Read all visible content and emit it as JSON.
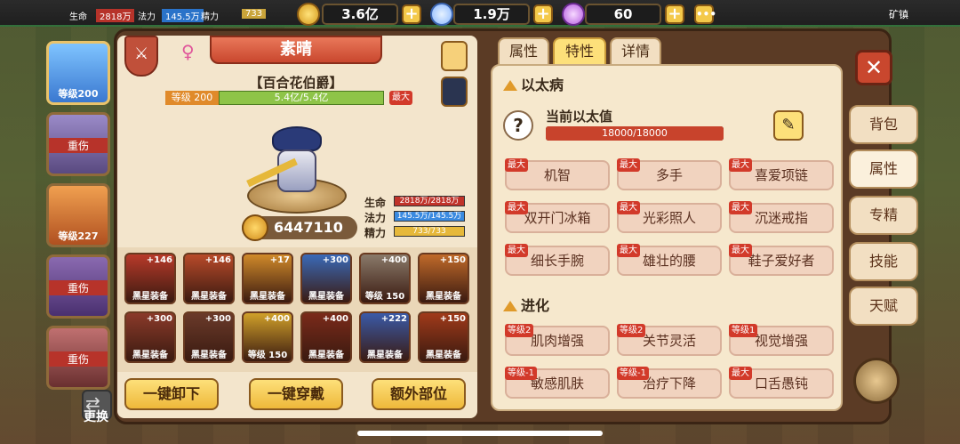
{
  "topbar": {
    "hp_label": "生命",
    "hp_value": "2818万",
    "mp_label": "法力",
    "mp_value": "145.5万",
    "spirit_label": "精力",
    "spirit_value": "733",
    "gold": "3.6亿",
    "gems": "1.9万",
    "crystals": "60",
    "mine_label": "矿镇"
  },
  "heroes": [
    {
      "label": "等级200"
    },
    {
      "label": "重伤"
    },
    {
      "label": "等级227"
    },
    {
      "label": "重伤"
    },
    {
      "label": "重伤"
    }
  ],
  "swap_label": "更换",
  "hero": {
    "name": "素晴",
    "title": "【百合花伯爵】",
    "level_label": "等级 200",
    "exp": "5.4亿/5.4亿",
    "max_badge": "最大",
    "power": "6447110",
    "stats": [
      {
        "label": "生命",
        "value": "2818万/2818万"
      },
      {
        "label": "法力",
        "value": "145.5万/145.5万"
      },
      {
        "label": "精力",
        "value": "733/733"
      }
    ]
  },
  "equipment": [
    {
      "plus": "+146",
      "label": "黑星装备"
    },
    {
      "plus": "+146",
      "label": "黑星装备"
    },
    {
      "plus": "+17",
      "label": "黑星装备"
    },
    {
      "plus": "+300",
      "label": "黑星装备"
    },
    {
      "plus": "+400",
      "label": "等级 150"
    },
    {
      "plus": "+150",
      "label": "黑星装备"
    },
    {
      "plus": "+300",
      "label": "黑星装备"
    },
    {
      "plus": "+300",
      "label": "黑星装备"
    },
    {
      "plus": "+400",
      "label": "等级 150"
    },
    {
      "plus": "+400",
      "label": "黑星装备"
    },
    {
      "plus": "+222",
      "label": "黑星装备"
    },
    {
      "plus": "+150",
      "label": "黑星装备"
    }
  ],
  "buttons": {
    "unequip_all": "一键卸下",
    "equip_all": "一键穿戴",
    "extra_slots": "额外部位"
  },
  "tabs": [
    {
      "label": "属性"
    },
    {
      "label": "特性"
    },
    {
      "label": "详情"
    }
  ],
  "ether": {
    "section": "以太病",
    "current_label": "当前以太值",
    "value": "18000/18000",
    "fill": 1.0
  },
  "traits": [
    {
      "badge": "最大",
      "label": "机智"
    },
    {
      "badge": "最大",
      "label": "多手"
    },
    {
      "badge": "最大",
      "label": "喜爱项链"
    },
    {
      "badge": "最大",
      "label": "双开门冰箱"
    },
    {
      "badge": "最大",
      "label": "光彩照人"
    },
    {
      "badge": "最大",
      "label": "沉迷戒指"
    },
    {
      "badge": "最大",
      "label": "细长手腕"
    },
    {
      "badge": "最大",
      "label": "雄壮的腰"
    },
    {
      "badge": "最大",
      "label": "鞋子爱好者"
    }
  ],
  "evolution": {
    "section": "进化",
    "items": [
      {
        "badge": "等级2",
        "label": "肌肉增强"
      },
      {
        "badge": "等级2",
        "label": "关节灵活"
      },
      {
        "badge": "等级1",
        "label": "视觉增强"
      },
      {
        "badge": "等级-1",
        "label": "敏感肌肤"
      },
      {
        "badge": "等级-1",
        "label": "治疗下降"
      },
      {
        "badge": "最大",
        "label": "口舌愚钝"
      }
    ]
  },
  "side_tabs": [
    {
      "label": "背包"
    },
    {
      "label": "属性"
    },
    {
      "label": "专精"
    },
    {
      "label": "技能"
    },
    {
      "label": "天赋"
    }
  ],
  "colors": {
    "accent": "#f4c94a",
    "trait_bg": "#f1d3bf",
    "badge": "#d23a2a",
    "ether_bar": "#c8432c"
  }
}
